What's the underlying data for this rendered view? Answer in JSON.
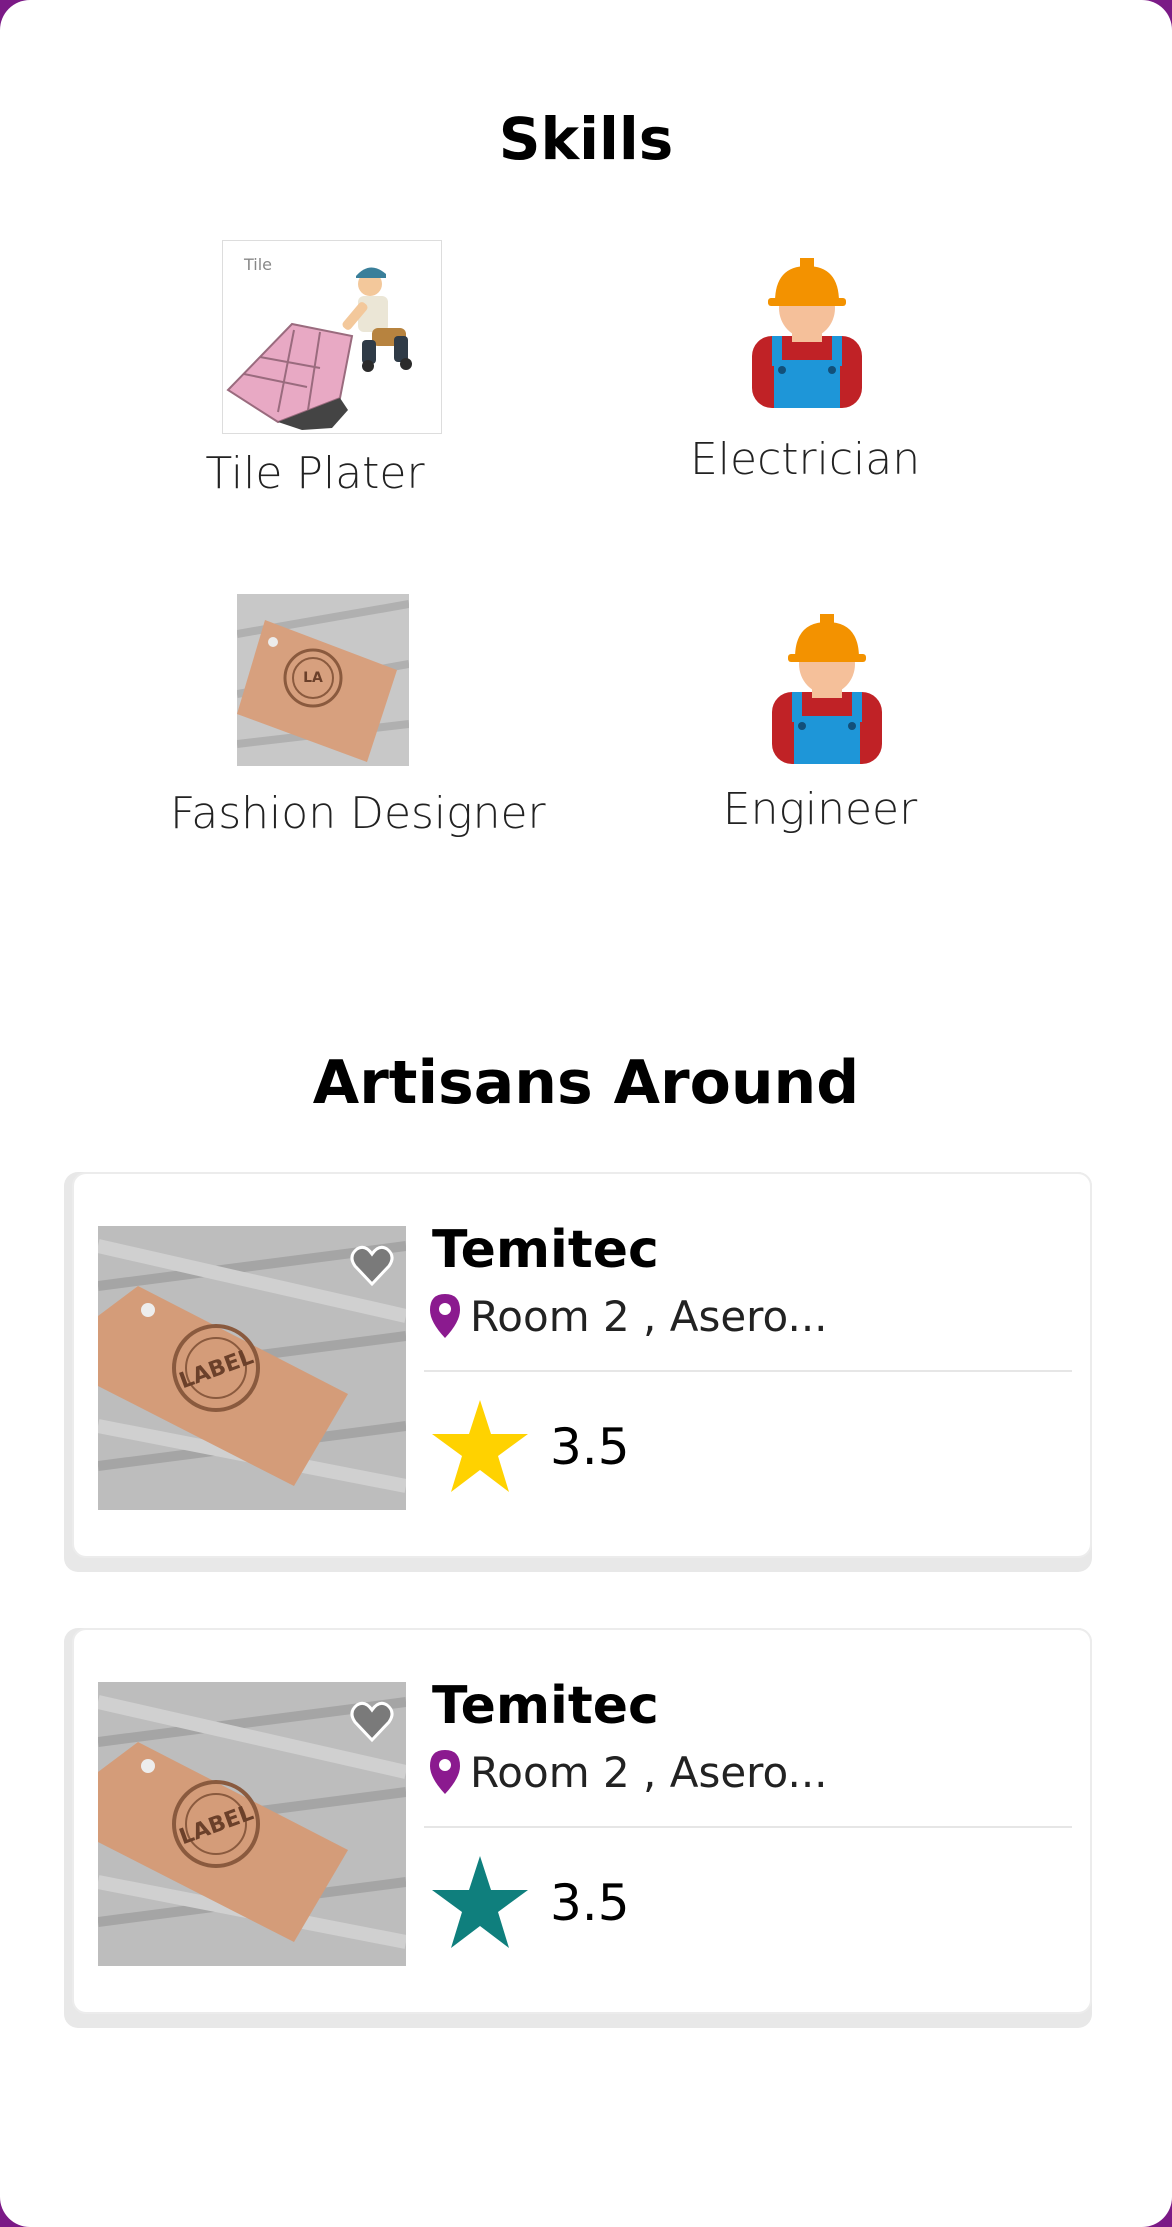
{
  "skills": {
    "title": "Skills",
    "items": [
      {
        "label": "Tile Plater",
        "image_text": "Tile"
      },
      {
        "label": "Electrician"
      },
      {
        "label": "Fashion Designer"
      },
      {
        "label": "Engineer"
      }
    ]
  },
  "artisans": {
    "title": "Artisans Around",
    "cards": [
      {
        "name": "Temitec",
        "address": "Room 2 , Asero...",
        "rating": "3.5",
        "star_color": "#ffd200"
      },
      {
        "name": "Temitec",
        "address": "Room 2 , Asero...",
        "rating": "3.5",
        "star_color": "#0f7f7d"
      }
    ]
  },
  "colors": {
    "frame": "#7b1a86",
    "pin": "#8b1a8f",
    "heart": "#7a7a7a"
  }
}
